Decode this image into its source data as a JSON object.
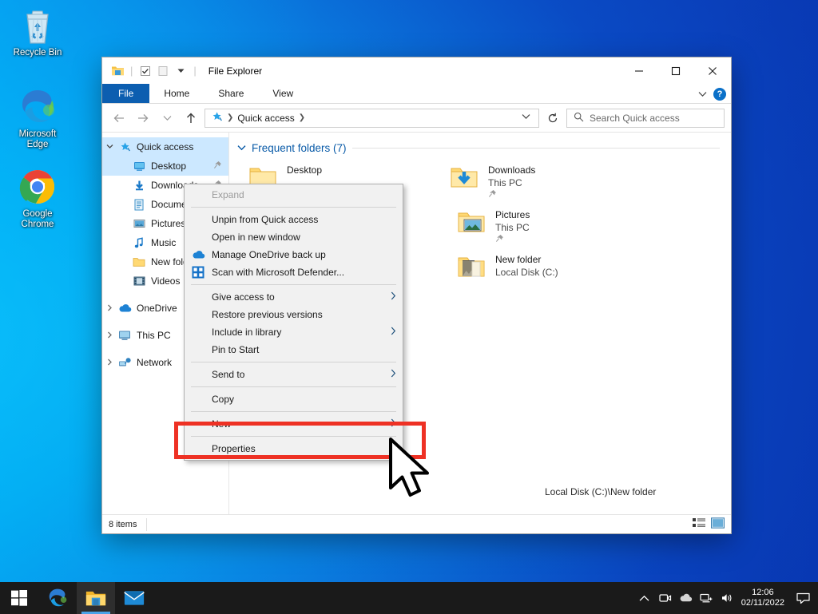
{
  "desktop": {
    "icons": [
      {
        "name": "recycle-bin",
        "label": "Recycle Bin"
      },
      {
        "name": "microsoft-edge",
        "label": "Microsoft\nEdge",
        "line1": "Microsoft",
        "line2": "Edge"
      },
      {
        "name": "google-chrome",
        "label": "Google\nChrome",
        "line1": "Google",
        "line2": "Chrome"
      }
    ],
    "background_left": "#00aeef",
    "background_right": "#0b40b8"
  },
  "window": {
    "title": "File Explorer",
    "controls": {
      "minimize": "—",
      "maximize": "□",
      "close": "✕"
    },
    "ribbon_tabs": [
      {
        "label": "File",
        "active": true
      },
      {
        "label": "Home",
        "active": false
      },
      {
        "label": "Share",
        "active": false
      },
      {
        "label": "View",
        "active": false
      }
    ],
    "help_label": "?",
    "address": {
      "crumbs": [
        "Quick access"
      ],
      "chevron": "˅",
      "refresh_title": "Refresh"
    },
    "search": {
      "placeholder": "Search Quick access",
      "value": ""
    },
    "status": {
      "items_text": "8 items"
    }
  },
  "sidebar": {
    "items": [
      {
        "label": "Quick access",
        "icon": "pin-star-icon",
        "level": 1,
        "expanded": true,
        "selected": true,
        "pinned": false
      },
      {
        "label": "Desktop",
        "icon": "desktop-icon",
        "level": 2,
        "selected": true,
        "pinned": true
      },
      {
        "label": "Downloads",
        "icon": "download-icon",
        "level": 2,
        "selected": false,
        "pinned": true
      },
      {
        "label": "Documents",
        "icon": "documents-icon",
        "level": 2,
        "selected": false,
        "pinned": true
      },
      {
        "label": "Pictures",
        "icon": "pictures-icon",
        "level": 2,
        "selected": false,
        "pinned": true
      },
      {
        "label": "Music",
        "icon": "music-icon",
        "level": 2,
        "selected": false,
        "pinned": false
      },
      {
        "label": "New folder",
        "icon": "folder-icon",
        "level": 2,
        "selected": false,
        "pinned": false
      },
      {
        "label": "Videos",
        "icon": "videos-icon",
        "level": 2,
        "selected": false,
        "pinned": false
      },
      {
        "label": "OneDrive",
        "icon": "onedrive-icon",
        "level": 1,
        "expanded": false,
        "selected": false
      },
      {
        "label": "This PC",
        "icon": "thispc-icon",
        "level": 1,
        "expanded": false,
        "selected": false
      },
      {
        "label": "Network",
        "icon": "network-icon",
        "level": 1,
        "expanded": false,
        "selected": false
      }
    ]
  },
  "content": {
    "group_header": "Frequent folders (7)",
    "tiles": [
      {
        "name": "Desktop",
        "sub": "",
        "icon": "folder-icon",
        "pinned": false
      },
      {
        "name": "Downloads",
        "sub": "This PC",
        "icon": "folder-download-icon",
        "pinned": true
      },
      {
        "name": "Pictures",
        "sub": "This PC",
        "icon": "folder-pictures-icon",
        "pinned": true
      },
      {
        "name": "New folder",
        "sub": "Local Disk (C:)",
        "icon": "folder-photos-icon",
        "pinned": false
      }
    ],
    "tooltip_path": "Local Disk (C:)\\New folder"
  },
  "context_menu": {
    "items": [
      {
        "label": "Expand",
        "type": "item",
        "disabled": true,
        "icon": "",
        "submenu": false
      },
      {
        "label": "",
        "type": "separator"
      },
      {
        "label": "Unpin from Quick access",
        "type": "item",
        "disabled": false,
        "icon": "",
        "submenu": false
      },
      {
        "label": "Open in new window",
        "type": "item",
        "disabled": false,
        "icon": "",
        "submenu": false
      },
      {
        "label": "Manage OneDrive back up",
        "type": "item",
        "disabled": false,
        "icon": "onedrive-icon",
        "submenu": false
      },
      {
        "label": "Scan with Microsoft Defender...",
        "type": "item",
        "disabled": false,
        "icon": "defender-icon",
        "submenu": false
      },
      {
        "label": "",
        "type": "separator"
      },
      {
        "label": "Give access to",
        "type": "item",
        "disabled": false,
        "icon": "",
        "submenu": true
      },
      {
        "label": "Restore previous versions",
        "type": "item",
        "disabled": false,
        "icon": "",
        "submenu": false
      },
      {
        "label": "Include in library",
        "type": "item",
        "disabled": false,
        "icon": "",
        "submenu": true
      },
      {
        "label": "Pin to Start",
        "type": "item",
        "disabled": false,
        "icon": "",
        "submenu": false
      },
      {
        "label": "",
        "type": "separator"
      },
      {
        "label": "Send to",
        "type": "item",
        "disabled": false,
        "icon": "",
        "submenu": true
      },
      {
        "label": "",
        "type": "separator"
      },
      {
        "label": "Copy",
        "type": "item",
        "disabled": false,
        "icon": "",
        "submenu": false
      },
      {
        "label": "",
        "type": "separator"
      },
      {
        "label": "New",
        "type": "item",
        "disabled": false,
        "icon": "",
        "submenu": true
      },
      {
        "label": "",
        "type": "separator"
      },
      {
        "label": "Properties",
        "type": "item",
        "disabled": false,
        "icon": "",
        "submenu": false
      }
    ]
  },
  "highlight": {
    "target": "Properties",
    "color": "#ee3124"
  },
  "taskbar": {
    "start_label": "Start",
    "apps": [
      {
        "name": "microsoft-edge",
        "active": false
      },
      {
        "name": "file-explorer",
        "active": true
      },
      {
        "name": "mail",
        "active": false
      }
    ],
    "tray": [
      {
        "name": "show-hidden-icons",
        "glyph": "∧"
      },
      {
        "name": "camera-icon",
        "glyph": ""
      },
      {
        "name": "onedrive-icon",
        "glyph": ""
      },
      {
        "name": "network-icon",
        "glyph": ""
      },
      {
        "name": "volume-icon",
        "glyph": ""
      }
    ],
    "clock": {
      "time": "12:06",
      "date": "02/11/2022"
    },
    "notifications_label": "Notifications"
  }
}
